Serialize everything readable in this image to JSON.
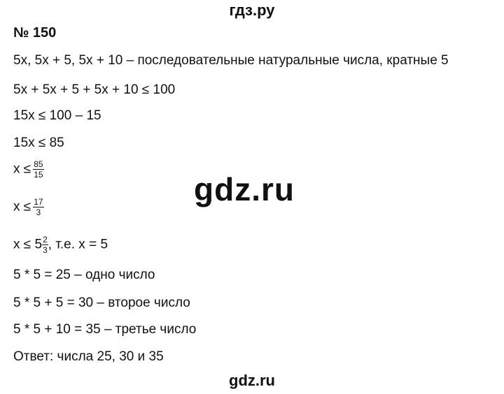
{
  "header": {
    "site": "гдз.ру"
  },
  "problem": {
    "number": "№ 150"
  },
  "lines": {
    "l1": "5x, 5x + 5, 5x + 10 – последовательные натуральные числа, кратные 5",
    "l2": "5x + 5x + 5 + 5x + 10 ≤ 100",
    "l3": "15x ≤ 100 – 15",
    "l4": "15x ≤ 85",
    "l5_prefix": "x ≤",
    "l5_num": "85",
    "l5_den": "15",
    "l6_prefix": "x ≤",
    "l6_num": "17",
    "l6_den": "3",
    "l7_prefix": "x ≤ 5",
    "l7_num": "2",
    "l7_den": "3",
    "l7_suffix": ", т.е. x = 5",
    "l8": "5 * 5 = 25 – одно число",
    "l9": "5 * 5 + 5 = 30 – второе число",
    "l10": "5 * 5 + 10 = 35 – третье число",
    "l11": "Ответ: числа 25, 30 и 35"
  },
  "watermark": {
    "center": "gdz.ru",
    "footer": "gdz.ru"
  }
}
